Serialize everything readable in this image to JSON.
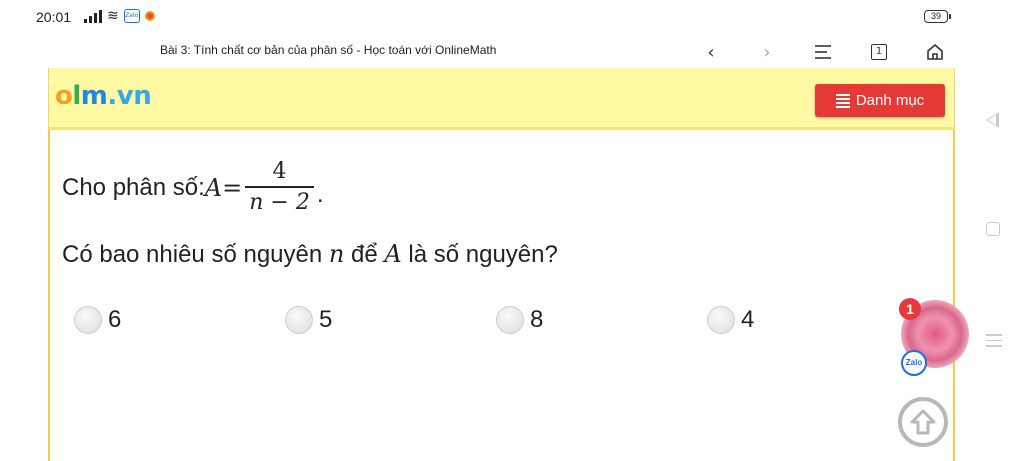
{
  "status_bar": {
    "time": "20:01",
    "battery": "39",
    "zalo_icon_text": "Zalo"
  },
  "browser": {
    "page_title": "Bài 3: Tính chất cơ bản của phân số - Học toán với OnlineMath",
    "back_icon": "‹",
    "forward_icon": "›",
    "tabs_count": "1"
  },
  "site": {
    "logo": {
      "o": "o",
      "l": "l",
      "m": "m",
      "rest": ".vn"
    },
    "menu_label": "Danh mục",
    "colors": {
      "header_bg": "#fff9a3",
      "menu_btn": "#e53935",
      "border": "#f0d040"
    }
  },
  "question": {
    "prefix": "Cho phân số: ",
    "var_a": "A",
    "equals": " = ",
    "numerator": "4",
    "denominator": "n − 2",
    "period": ".",
    "line2_prefix": "Có bao nhiêu số nguyên ",
    "var_n": "n",
    "line2_mid": " để ",
    "var_a2": "A",
    "line2_suffix": " là số nguyên?"
  },
  "options": [
    {
      "label": "6"
    },
    {
      "label": "5"
    },
    {
      "label": "8"
    },
    {
      "label": "4"
    }
  ],
  "floating": {
    "badge_count": "1",
    "zalo_label": "Zalo"
  }
}
